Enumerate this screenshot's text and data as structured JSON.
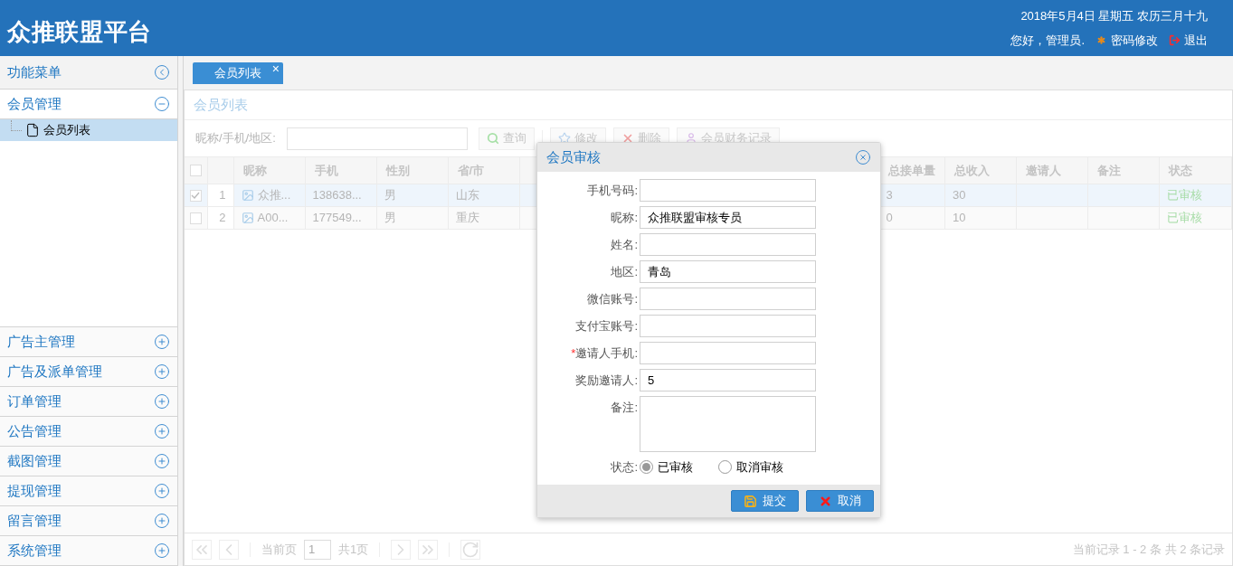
{
  "header": {
    "title": "众推联盟平台",
    "date": "2018年5月4日 星期五 农历三月十九",
    "greeting": "您好，管理员.",
    "links": [
      {
        "label": "密码修改",
        "kind": "password"
      },
      {
        "label": "退出",
        "kind": "logout"
      }
    ]
  },
  "sidebar": {
    "title": "功能菜单",
    "groups": [
      {
        "label": "会员管理",
        "expanded": true,
        "children": [
          {
            "label": "会员列表",
            "selected": true
          }
        ]
      },
      {
        "label": "广告主管理",
        "expanded": false
      },
      {
        "label": "广告及派单管理",
        "expanded": false
      },
      {
        "label": "订单管理",
        "expanded": false
      },
      {
        "label": "公告管理",
        "expanded": false
      },
      {
        "label": "截图管理",
        "expanded": false
      },
      {
        "label": "提现管理",
        "expanded": false
      },
      {
        "label": "留言管理",
        "expanded": false
      },
      {
        "label": "系统管理",
        "expanded": false
      }
    ]
  },
  "tabs": [
    {
      "label": "会员列表",
      "selected": true,
      "close": "×"
    }
  ],
  "panel": {
    "title": "会员列表",
    "search_label": "昵称/手机/地区:",
    "query_button": "查询",
    "toolbar": [
      {
        "label": "修改",
        "kind": "edit"
      },
      {
        "label": "删除",
        "kind": "delete"
      },
      {
        "label": "会员财务记录",
        "kind": "finance"
      }
    ]
  },
  "table": {
    "all_checked": false,
    "columns": [
      "昵称",
      "手机",
      "性别",
      "省/市",
      "总接单量",
      "总收入",
      "邀请人",
      "备注",
      "状态"
    ],
    "rows": [
      {
        "checked": true,
        "index": "1",
        "nickname": "众推...",
        "phone": "138638...",
        "gender": "男",
        "province": "山东",
        "total_orders": "3",
        "total_income": "30",
        "status": "已审核"
      },
      {
        "checked": false,
        "index": "2",
        "nickname": "A00...",
        "phone": "177549...",
        "gender": "男",
        "province": "重庆",
        "total_orders": "0",
        "total_income": "10",
        "status": "已审核"
      }
    ]
  },
  "pagination": {
    "page_label": "当前页",
    "page": "1",
    "total_pages": "共1页",
    "summary": "当前记录 1 - 2 条 共 2 条记录"
  },
  "modal": {
    "title": "会员审核",
    "fields": [
      {
        "label": "手机号码:",
        "kind": "text"
      },
      {
        "label": "昵称:",
        "kind": "text",
        "value": "众推联盟审核专员"
      },
      {
        "label": "姓名:",
        "kind": "text"
      },
      {
        "label": "地区:",
        "kind": "text",
        "value": "青岛"
      },
      {
        "label": "微信账号:",
        "kind": "text"
      },
      {
        "label": "支付宝账号:",
        "kind": "text"
      },
      {
        "label": "邀请人手机:",
        "kind": "text",
        "required_mark": "*"
      },
      {
        "label": "奖励邀请人:",
        "kind": "text",
        "value": "5"
      },
      {
        "label": "备注:",
        "kind": "textarea"
      }
    ],
    "status": {
      "label": "状态:",
      "options": [
        {
          "label": "已审核",
          "selected": true
        },
        {
          "label": "取消审核",
          "selected": false
        }
      ]
    },
    "buttons": [
      {
        "label": "提交",
        "kind": "submit"
      },
      {
        "label": "取消",
        "kind": "cancel"
      }
    ]
  }
}
